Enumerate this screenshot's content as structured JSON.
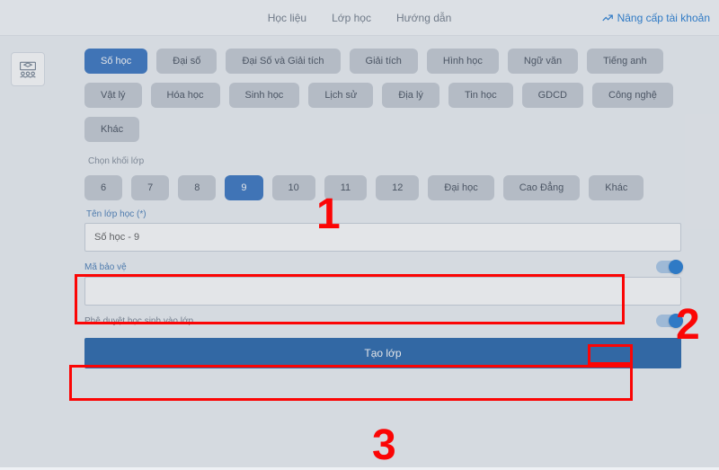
{
  "nav": {
    "a": "Học liệu",
    "b": "Lớp học",
    "c": "Hướng dẫn"
  },
  "upgrade": "Nâng cấp tài khoản",
  "subjects": [
    {
      "t": "Số học",
      "active": true
    },
    {
      "t": "Đại số"
    },
    {
      "t": "Đại Số và Giải tích"
    },
    {
      "t": "Giải tích"
    },
    {
      "t": "Hình học"
    },
    {
      "t": "Ngữ văn"
    },
    {
      "t": "Tiếng anh"
    },
    {
      "t": "Vật lý"
    },
    {
      "t": "Hóa học"
    },
    {
      "t": "Sinh học"
    },
    {
      "t": "Lịch sử"
    },
    {
      "t": "Địa lý"
    },
    {
      "t": "Tin học"
    },
    {
      "t": "GDCD"
    },
    {
      "t": "Công nghệ"
    },
    {
      "t": "Khác"
    }
  ],
  "gradeLabel": "Chọn khối lớp",
  "grades": [
    {
      "t": "6"
    },
    {
      "t": "7"
    },
    {
      "t": "8"
    },
    {
      "t": "9",
      "active": true
    },
    {
      "t": "10"
    },
    {
      "t": "11"
    },
    {
      "t": "12"
    },
    {
      "t": "Đại học"
    },
    {
      "t": "Cao Đẳng"
    },
    {
      "t": "Khác"
    }
  ],
  "form": {
    "classNameLabel": "Tên lớp học (*)",
    "classNameValue": "Số học - 9",
    "passLabel": "Mã bảo vệ",
    "passValue": "",
    "approveLabel": "Phê duyệt học sinh vào lớp",
    "createBtn": "Tạo lớp"
  },
  "anno": {
    "n1": "1",
    "n2": "2",
    "n3": "3"
  }
}
